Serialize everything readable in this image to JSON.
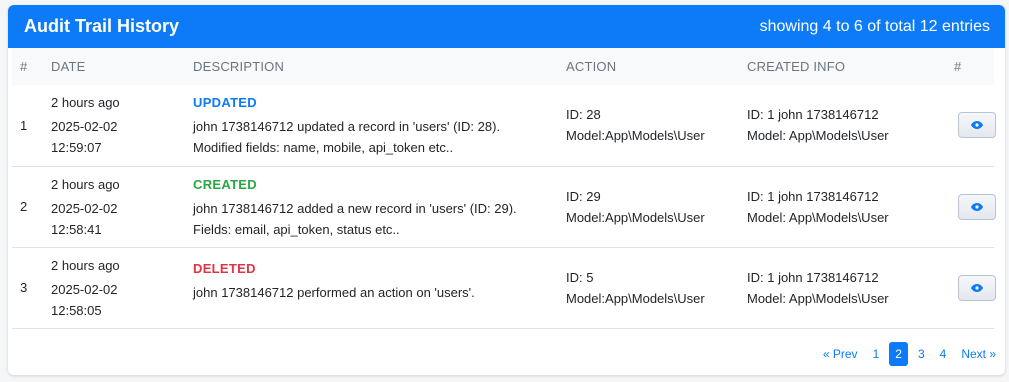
{
  "header": {
    "title": "Audit Trail History",
    "summary": "showing 4 to 6 of total 12 entries"
  },
  "columns": [
    "#",
    "DATE",
    "DESCRIPTION",
    "ACTION",
    "CREATED INFO",
    "#"
  ],
  "rows": [
    {
      "num": "1",
      "ago": "2 hours ago",
      "date": "2025-02-02",
      "time": "12:59:07",
      "event": "UPDATED",
      "desc1": "john 1738146712 updated a record in 'users' (ID: 28).",
      "desc2": "Modified fields: name, mobile, api_token etc..",
      "action_id": "ID: 28",
      "action_model": "Model:App\\Models\\User",
      "created_id": "ID: 1 john 1738146712",
      "created_model": "Model: App\\Models\\User"
    },
    {
      "num": "2",
      "ago": "2 hours ago",
      "date": "2025-02-02",
      "time": "12:58:41",
      "event": "CREATED",
      "desc1": "john 1738146712 added a new record in 'users' (ID: 29).",
      "desc2": "Fields: email, api_token, status etc..",
      "action_id": "ID: 29",
      "action_model": "Model:App\\Models\\User",
      "created_id": "ID: 1 john 1738146712",
      "created_model": "Model: App\\Models\\User"
    },
    {
      "num": "3",
      "ago": "2 hours ago",
      "date": "2025-02-02",
      "time": "12:58:05",
      "event": "DELETED",
      "desc1": "john 1738146712 performed an action on 'users'.",
      "desc2": "",
      "action_id": "ID: 5",
      "action_model": "Model:App\\Models\\User",
      "created_id": "ID: 1 john 1738146712",
      "created_model": "Model: App\\Models\\User"
    }
  ],
  "pagination": {
    "prev": "« Prev",
    "pages": [
      "1",
      "2",
      "3",
      "4"
    ],
    "active": "2",
    "next": "Next »"
  },
  "colors": {
    "accent": "#0d7bf7",
    "updated": "#0d7bf7",
    "created": "#28a745",
    "deleted": "#dc3545"
  },
  "icons": {
    "view": "eye-icon"
  }
}
